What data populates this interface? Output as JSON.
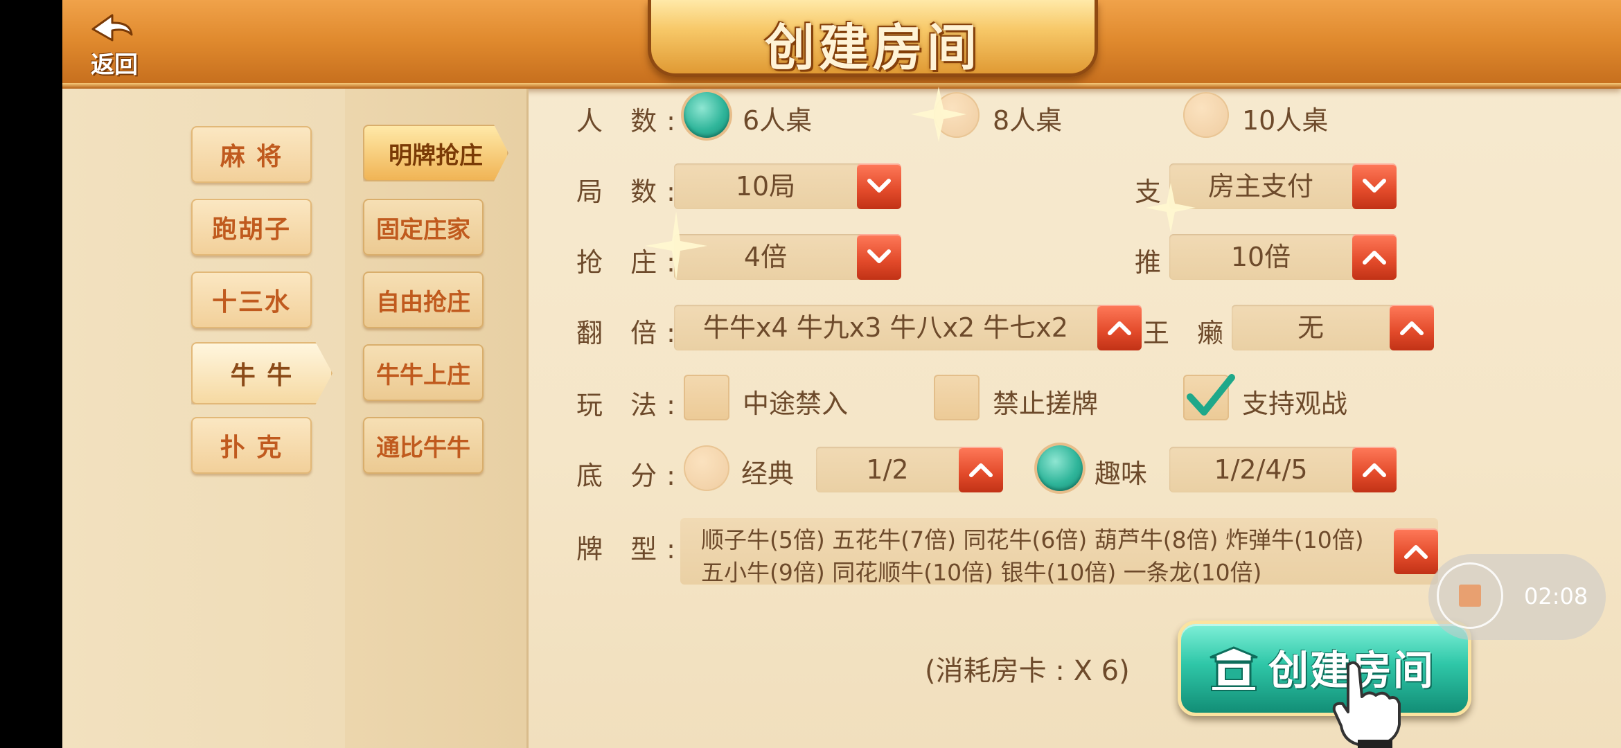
{
  "header": {
    "title": "创建房间",
    "back_label": "返回"
  },
  "game_types": [
    {
      "label": "麻 将",
      "active": false
    },
    {
      "label": "跑胡子",
      "active": false
    },
    {
      "label": "十三水",
      "active": false
    },
    {
      "label": "牛 牛",
      "active": true
    },
    {
      "label": "扑 克",
      "active": false
    }
  ],
  "game_modes": [
    {
      "label": "明牌抢庄",
      "active": true
    },
    {
      "label": "固定庄家",
      "active": false
    },
    {
      "label": "自由抢庄",
      "active": false
    },
    {
      "label": "牛牛上庄",
      "active": false
    },
    {
      "label": "通比牛牛",
      "active": false
    }
  ],
  "form": {
    "players": {
      "label": "人 数:",
      "options": [
        {
          "label": "6人桌",
          "selected": true
        },
        {
          "label": "8人桌",
          "selected": false
        },
        {
          "label": "10人桌",
          "selected": false
        }
      ]
    },
    "rounds": {
      "label": "局 数:",
      "value": "10局"
    },
    "payment": {
      "label": "支 付:",
      "value": "房主支付"
    },
    "grab_banker": {
      "label": "抢 庄:",
      "value": "4倍"
    },
    "bet": {
      "label": "推 注:",
      "value": "10倍"
    },
    "multiplier": {
      "label": "翻 倍:",
      "value": "牛牛x4 牛九x3 牛八x2 牛七x2"
    },
    "wildcard": {
      "label": "王 癞:",
      "value": "无"
    },
    "rules": {
      "label": "玩 法:",
      "options": [
        {
          "label": "中途禁入",
          "checked": false
        },
        {
          "label": "禁止搓牌",
          "checked": false
        },
        {
          "label": "支持观战",
          "checked": true
        }
      ]
    },
    "base_score": {
      "label": "底 分:",
      "classic_label": "经典",
      "classic_selected": false,
      "classic_value": "1/2",
      "fun_label": "趣味",
      "fun_selected": true,
      "fun_value": "1/2/4/5"
    },
    "card_types": {
      "label": "牌 型:",
      "line1": "顺子牛(5倍) 五花牛(7倍) 同花牛(6倍) 葫芦牛(8倍) 炸弹牛(10倍)",
      "line2": "五小牛(9倍) 同花顺牛(10倍) 银牛(10倍) 一条龙(10倍)"
    }
  },
  "footer": {
    "cost_text": "(消耗房卡 : X 6)",
    "create_label": "创建房间"
  },
  "recorder": {
    "time": "02:08"
  },
  "colors": {
    "accent_teal": "#2fb59a",
    "dropdown_red": "#e24a2a",
    "text_brown": "#6d4a2b",
    "header_orange": "#e08a2e"
  }
}
